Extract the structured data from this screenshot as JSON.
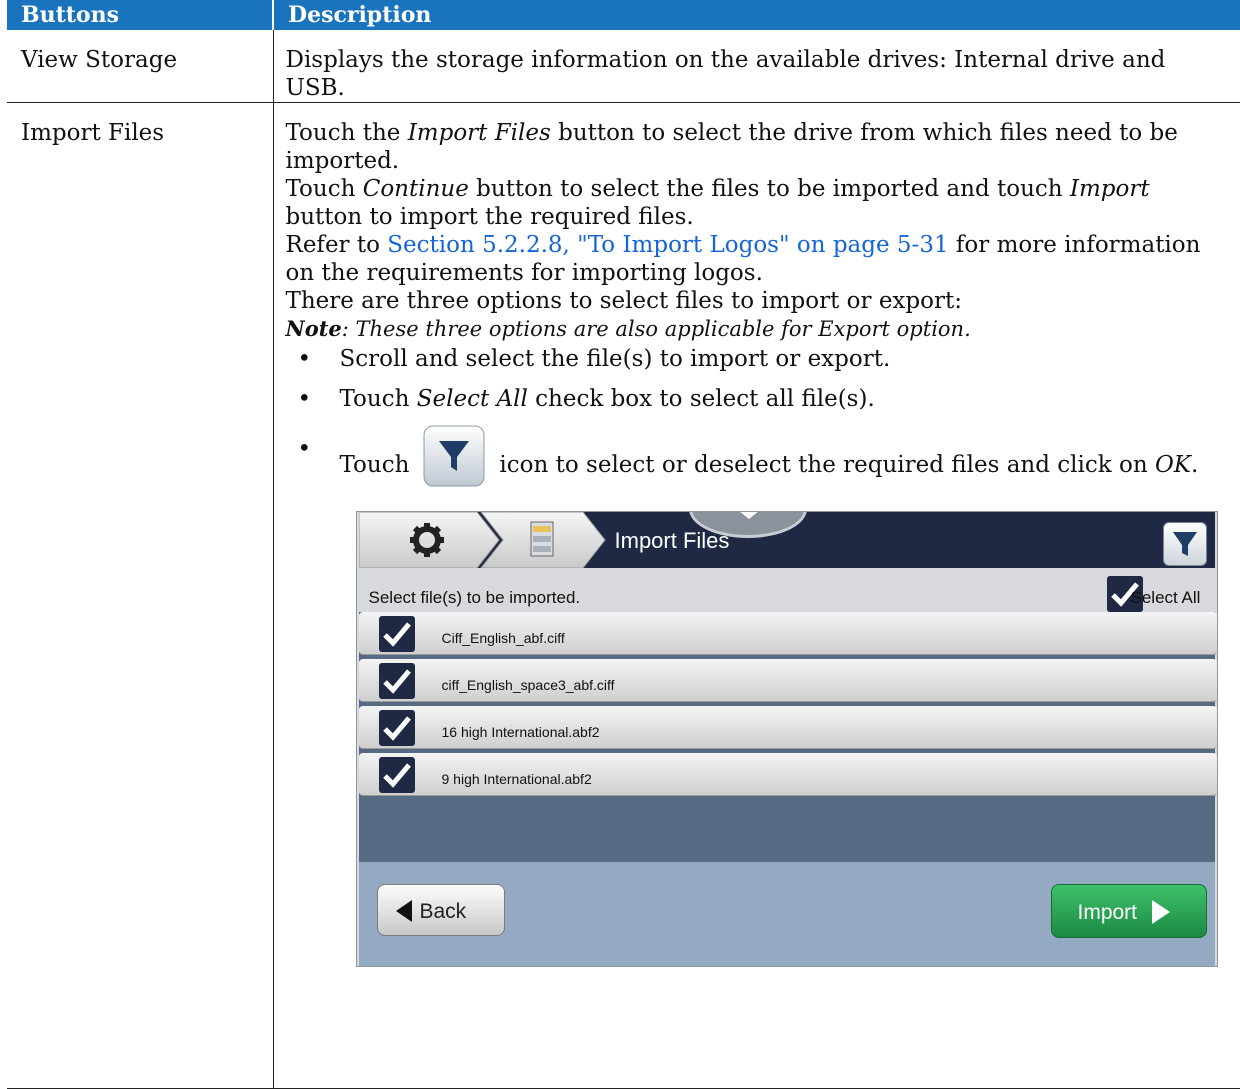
{
  "table": {
    "headers": [
      "Buttons",
      "Description"
    ],
    "rows": [
      {
        "button": "View Storage",
        "description": "Displays the storage information on the available drives: Internal drive and USB."
      },
      {
        "button": "Import Files",
        "p1_a": "Touch the ",
        "p1_em": "Import Files",
        "p1_b": " button to select the drive from which files need to be imported.",
        "p2_a": "Touch ",
        "p2_em1": "Continue",
        "p2_b": " button to select the files to be imported and touch ",
        "p2_em2": "Import",
        "p2_c": " button to import the required files.",
        "p3_a": "Refer to ",
        "p3_link": "Section 5.2.2.8, \"To Import Logos\" on page 5-31",
        "p3_b": " for more information on the requirements for importing logos.",
        "p4": "There are three options to select files to import or export:",
        "note_label": "Note",
        "note_text": ": These three options are also applicable for Export option.",
        "bullet": "•",
        "opt1": "Scroll and select the file(s) to import or export.",
        "opt2_a": "Touch ",
        "opt2_em": "Select All",
        "opt2_b": " check box to select all file(s).",
        "opt3_a": "Touch",
        "opt3_b": "icon to select or deselect the required files and click on ",
        "opt3_em": "OK",
        "opt3_c": "."
      }
    ]
  },
  "screenshot": {
    "title": "Import Files",
    "instruction": "Select file(s) to be imported.",
    "select_all_label": "Select All",
    "select_all_checked": true,
    "files": [
      {
        "name": "Ciff_English_abf.ciff",
        "checked": true
      },
      {
        "name": "ciff_English_space3_abf.ciff",
        "checked": true
      },
      {
        "name": "16 high International.abf2",
        "checked": true
      },
      {
        "name": "9 high International.abf2",
        "checked": true
      }
    ],
    "back_label": "Back",
    "import_label": "Import",
    "icons": [
      "gear-icon",
      "file-cabinet-icon",
      "filter-icon"
    ],
    "colors": {
      "header_blue": "#1a73bd",
      "link_blue": "#1565d8",
      "topbar_navy": "#1f2944",
      "list_bg": "#566b83",
      "bottom_bar": "#94aac3",
      "import_green": "#22994c"
    }
  }
}
